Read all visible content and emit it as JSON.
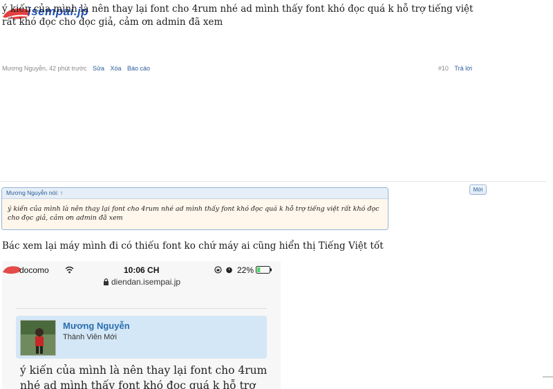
{
  "site": {
    "logo_text": "isempai.jp"
  },
  "post": {
    "text": "ý kiến của mình là nên thay lại font cho 4rum nhé ad mình thấy font khó đọc quá k hỗ trợ tiếng việt rất khó đọc cho đọc giả, cảm ơn admin đã xem",
    "author_time": "Mương Nguyễn, 42 phút trước",
    "actions": [
      "Sửa",
      "Xóa",
      "Báo cáo"
    ],
    "number": "#10",
    "reply_label": "Trả lời"
  },
  "new_badge": "Mới",
  "quote": {
    "header": "Mương Nguyễn nói: ↑",
    "body": "ý kiến của mình là nên thay lại font cho 4rum nhé ad mình thấy font khó đọc quá k hỗ trợ tiếng việt rất khó đọc cho đọc giả, cảm ơn admin đã xem"
  },
  "reply": {
    "text": "Bác xem lại máy mình đi có thiếu font ko chứ máy ai cũng hiển thị Tiếng Việt tốt"
  },
  "screenshot": {
    "carrier": "docomo",
    "time": "10:06 CH",
    "battery": "22%",
    "url": "diendan.isempai.jp",
    "user_name": "Mương Nguyễn",
    "user_role": "Thành Viên Mới",
    "body_text": "ý kiến của mình là nên thay lại font cho 4rum nhé ad mình thấy font khó đọc quá k hỗ trợ tiếng việt",
    "icons": [
      "wifi-icon",
      "lock-icon",
      "alarm-icon",
      "battery-icon"
    ]
  },
  "colors": {
    "link": "#2b5c9a",
    "accent_red": "#e02b2b",
    "quote_bg": "#fff6ec",
    "card_bg": "#d4e7f6"
  }
}
